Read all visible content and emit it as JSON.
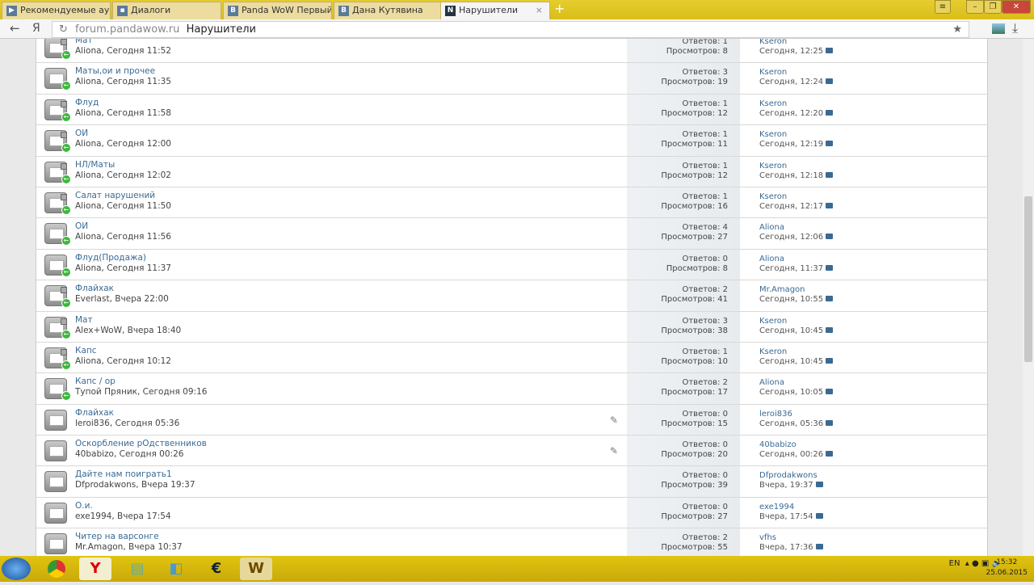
{
  "browser": {
    "tabs": [
      {
        "label": "Рекомендуемые ауд",
        "icon": "▶"
      },
      {
        "label": "Диалоги",
        "icon": "▪"
      },
      {
        "label": "Panda WoW Первый",
        "icon": "В"
      },
      {
        "label": "Дана Кутявина",
        "icon": "В"
      },
      {
        "label": "Нарушители",
        "icon": "N"
      }
    ],
    "url_host": "forum.pandawow.ru",
    "url_title": "Нарушители",
    "back": "←",
    "ya": "Я",
    "reload": "↻",
    "star": "★",
    "download": "⤓",
    "new_tab": "+",
    "menu": "≡",
    "minimize": "–",
    "maximize": "❐",
    "close": "✕"
  },
  "replies_label": "Ответов:",
  "views_label": "Просмотров:",
  "threads": [
    {
      "title": "Мат",
      "meta": "Aliona, Сегодня 11:52",
      "replies": "1",
      "views": "8",
      "last_user": "Kseron",
      "last_date": "Сегодня, 12:25",
      "locked": true,
      "moved": true,
      "clip": false
    },
    {
      "title": "Маты,ои и прочее",
      "meta": "Aliona, Сегодня 11:35",
      "replies": "3",
      "views": "19",
      "last_user": "Kseron",
      "last_date": "Сегодня, 12:24",
      "locked": false,
      "moved": true,
      "clip": false
    },
    {
      "title": "Флуд",
      "meta": "Aliona, Сегодня 11:58",
      "replies": "1",
      "views": "12",
      "last_user": "Kseron",
      "last_date": "Сегодня, 12:20",
      "locked": true,
      "moved": true,
      "clip": false
    },
    {
      "title": "ОИ",
      "meta": "Aliona, Сегодня 12:00",
      "replies": "1",
      "views": "11",
      "last_user": "Kseron",
      "last_date": "Сегодня, 12:19",
      "locked": true,
      "moved": true,
      "clip": false
    },
    {
      "title": "НЛ/Маты",
      "meta": "Aliona, Сегодня 12:02",
      "replies": "1",
      "views": "12",
      "last_user": "Kseron",
      "last_date": "Сегодня, 12:18",
      "locked": true,
      "moved": true,
      "clip": false
    },
    {
      "title": "Салат нарушений",
      "meta": "Aliona, Сегодня 11:50",
      "replies": "1",
      "views": "16",
      "last_user": "Kseron",
      "last_date": "Сегодня, 12:17",
      "locked": true,
      "moved": true,
      "clip": false
    },
    {
      "title": "ОИ",
      "meta": "Aliona, Сегодня 11:56",
      "replies": "4",
      "views": "27",
      "last_user": "Aliona",
      "last_date": "Сегодня, 12:06",
      "locked": false,
      "moved": true,
      "clip": false
    },
    {
      "title": "Флуд(Продажа)",
      "meta": "Aliona, Сегодня 11:37",
      "replies": "0",
      "views": "8",
      "last_user": "Aliona",
      "last_date": "Сегодня, 11:37",
      "locked": false,
      "moved": true,
      "clip": false
    },
    {
      "title": "Флайхак",
      "meta": "Everlast, Вчера 22:00",
      "replies": "2",
      "views": "41",
      "last_user": "Mr.Amagon",
      "last_date": "Сегодня, 10:55",
      "locked": true,
      "moved": true,
      "clip": false
    },
    {
      "title": "Мат",
      "meta": "Alex+WoW, Вчера 18:40",
      "replies": "3",
      "views": "38",
      "last_user": "Kseron",
      "last_date": "Сегодня, 10:45",
      "locked": true,
      "moved": true,
      "clip": false
    },
    {
      "title": "Капс",
      "meta": "Aliona, Сегодня 10:12",
      "replies": "1",
      "views": "10",
      "last_user": "Kseron",
      "last_date": "Сегодня, 10:45",
      "locked": true,
      "moved": true,
      "clip": false
    },
    {
      "title": "Капс / ор",
      "meta": "Тупой Пряник, Сегодня 09:16",
      "replies": "2",
      "views": "17",
      "last_user": "Aliona",
      "last_date": "Сегодня, 10:05",
      "locked": false,
      "moved": true,
      "clip": false
    },
    {
      "title": "Флайхак",
      "meta": "leroi836, Сегодня 05:36",
      "replies": "0",
      "views": "15",
      "last_user": "leroi836",
      "last_date": "Сегодня, 05:36",
      "locked": false,
      "moved": false,
      "clip": true
    },
    {
      "title": "Оскорбление рОдственников",
      "meta": "40babizo, Сегодня 00:26",
      "replies": "0",
      "views": "20",
      "last_user": "40babizo",
      "last_date": "Сегодня, 00:26",
      "locked": false,
      "moved": false,
      "clip": true
    },
    {
      "title": "Дайте нам поиграть1",
      "meta": "Dfprodakwons, Вчера 19:37",
      "replies": "0",
      "views": "39",
      "last_user": "Dfprodakwons",
      "last_date": "Вчера, 19:37",
      "locked": false,
      "moved": false,
      "clip": false
    },
    {
      "title": "О.и.",
      "meta": "exe1994, Вчера 17:54",
      "replies": "0",
      "views": "27",
      "last_user": "exe1994",
      "last_date": "Вчера, 17:54",
      "locked": false,
      "moved": false,
      "clip": false
    },
    {
      "title": "Читер на варсонге",
      "meta": "Mr.Amagon, Вчера 10:37",
      "replies": "2",
      "views": "55",
      "last_user": "vfhs",
      "last_date": "Вчера, 17:36",
      "locked": false,
      "moved": false,
      "clip": false
    }
  ],
  "taskbar": {
    "lang": "EN",
    "time": "15:32",
    "date": "25.06.2015"
  }
}
